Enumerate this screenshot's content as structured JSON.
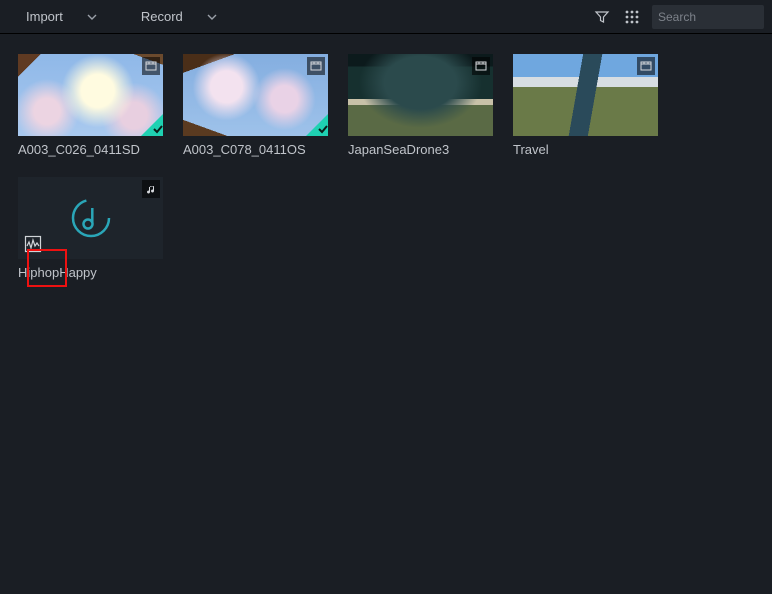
{
  "toolbar": {
    "import_label": "Import",
    "record_label": "Record",
    "search_placeholder": "Search"
  },
  "media": [
    {
      "label": "A003_C026_0411SD",
      "type": "video",
      "thumb": "blossom1",
      "used": true
    },
    {
      "label": "A003_C078_0411OS",
      "type": "video",
      "thumb": "blossom2",
      "used": true
    },
    {
      "label": "JapanSeaDrone3",
      "type": "video",
      "thumb": "drone",
      "used": false
    },
    {
      "label": "Travel",
      "type": "video",
      "thumb": "travel",
      "used": false
    },
    {
      "label": "HiphopHappy",
      "type": "audio",
      "thumb": "audio",
      "used": false
    }
  ],
  "icons": {
    "filter": "filter-icon",
    "grid": "grid-view-icon",
    "search": "search-icon",
    "video_clip": "video-clip-icon",
    "music": "music-note-icon",
    "beat_detect": "beat-detection-icon"
  }
}
